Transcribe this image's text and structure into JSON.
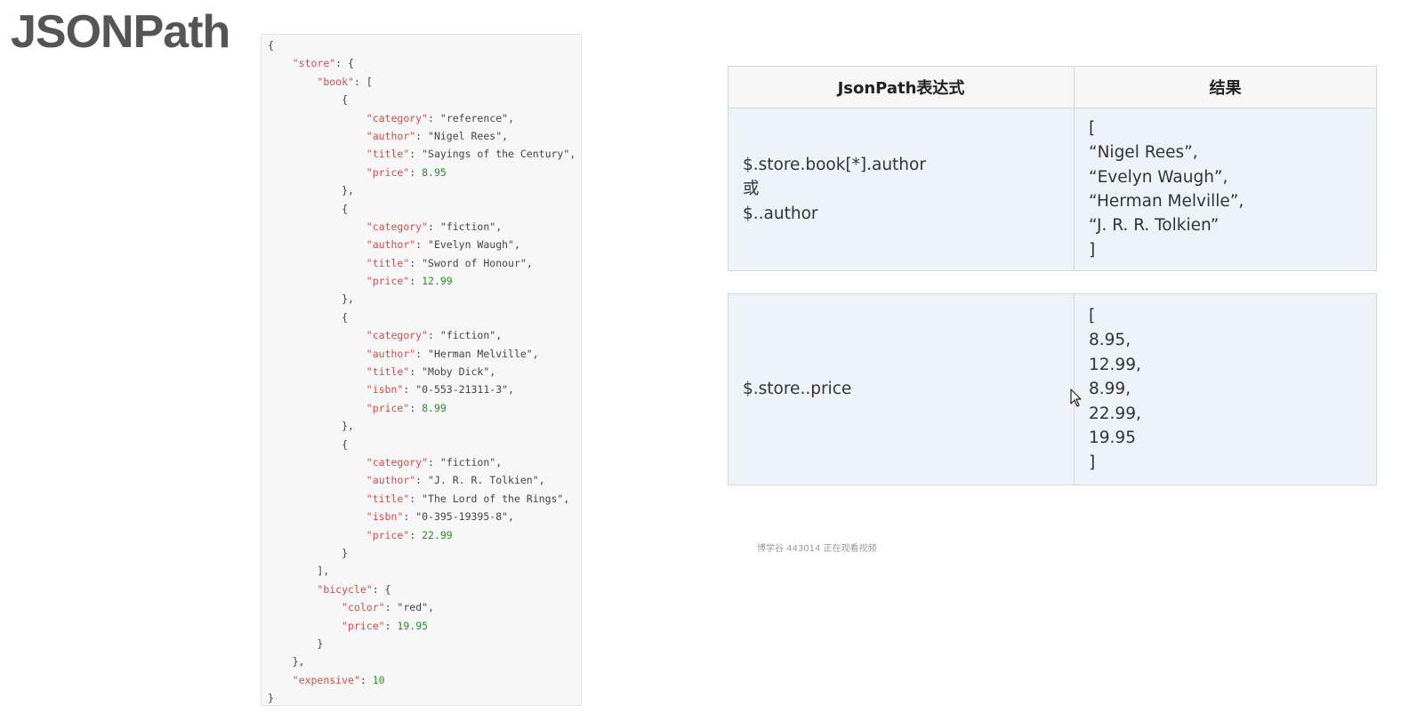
{
  "title": "JSONPath",
  "code_lines": [
    [
      {
        "t": "{",
        "c": "p"
      }
    ],
    [
      {
        "t": "    ",
        "c": "p"
      },
      {
        "t": "\"store\"",
        "c": "k"
      },
      {
        "t": ": {",
        "c": "p"
      }
    ],
    [
      {
        "t": "        ",
        "c": "p"
      },
      {
        "t": "\"book\"",
        "c": "k"
      },
      {
        "t": ": [",
        "c": "p"
      }
    ],
    [
      {
        "t": "            {",
        "c": "p"
      }
    ],
    [
      {
        "t": "                ",
        "c": "p"
      },
      {
        "t": "\"category\"",
        "c": "k"
      },
      {
        "t": ": ",
        "c": "p"
      },
      {
        "t": "\"reference\"",
        "c": "s"
      },
      {
        "t": ",",
        "c": "p"
      }
    ],
    [
      {
        "t": "                ",
        "c": "p"
      },
      {
        "t": "\"author\"",
        "c": "k"
      },
      {
        "t": ": ",
        "c": "p"
      },
      {
        "t": "\"Nigel Rees\"",
        "c": "s"
      },
      {
        "t": ",",
        "c": "p"
      }
    ],
    [
      {
        "t": "                ",
        "c": "p"
      },
      {
        "t": "\"title\"",
        "c": "k"
      },
      {
        "t": ": ",
        "c": "p"
      },
      {
        "t": "\"Sayings of the Century\"",
        "c": "s"
      },
      {
        "t": ",",
        "c": "p"
      }
    ],
    [
      {
        "t": "                ",
        "c": "p"
      },
      {
        "t": "\"price\"",
        "c": "k"
      },
      {
        "t": ": ",
        "c": "p"
      },
      {
        "t": "8.95",
        "c": "n"
      }
    ],
    [
      {
        "t": "            },",
        "c": "p"
      }
    ],
    [
      {
        "t": "            {",
        "c": "p"
      }
    ],
    [
      {
        "t": "                ",
        "c": "p"
      },
      {
        "t": "\"category\"",
        "c": "k"
      },
      {
        "t": ": ",
        "c": "p"
      },
      {
        "t": "\"fiction\"",
        "c": "s"
      },
      {
        "t": ",",
        "c": "p"
      }
    ],
    [
      {
        "t": "                ",
        "c": "p"
      },
      {
        "t": "\"author\"",
        "c": "k"
      },
      {
        "t": ": ",
        "c": "p"
      },
      {
        "t": "\"Evelyn Waugh\"",
        "c": "s"
      },
      {
        "t": ",",
        "c": "p"
      }
    ],
    [
      {
        "t": "                ",
        "c": "p"
      },
      {
        "t": "\"title\"",
        "c": "k"
      },
      {
        "t": ": ",
        "c": "p"
      },
      {
        "t": "\"Sword of Honour\"",
        "c": "s"
      },
      {
        "t": ",",
        "c": "p"
      }
    ],
    [
      {
        "t": "                ",
        "c": "p"
      },
      {
        "t": "\"price\"",
        "c": "k"
      },
      {
        "t": ": ",
        "c": "p"
      },
      {
        "t": "12.99",
        "c": "n"
      }
    ],
    [
      {
        "t": "            },",
        "c": "p"
      }
    ],
    [
      {
        "t": "            {",
        "c": "p"
      }
    ],
    [
      {
        "t": "                ",
        "c": "p"
      },
      {
        "t": "\"category\"",
        "c": "k"
      },
      {
        "t": ": ",
        "c": "p"
      },
      {
        "t": "\"fiction\"",
        "c": "s"
      },
      {
        "t": ",",
        "c": "p"
      }
    ],
    [
      {
        "t": "                ",
        "c": "p"
      },
      {
        "t": "\"author\"",
        "c": "k"
      },
      {
        "t": ": ",
        "c": "p"
      },
      {
        "t": "\"Herman Melville\"",
        "c": "s"
      },
      {
        "t": ",",
        "c": "p"
      }
    ],
    [
      {
        "t": "                ",
        "c": "p"
      },
      {
        "t": "\"title\"",
        "c": "k"
      },
      {
        "t": ": ",
        "c": "p"
      },
      {
        "t": "\"Moby Dick\"",
        "c": "s"
      },
      {
        "t": ",",
        "c": "p"
      }
    ],
    [
      {
        "t": "                ",
        "c": "p"
      },
      {
        "t": "\"isbn\"",
        "c": "k"
      },
      {
        "t": ": ",
        "c": "p"
      },
      {
        "t": "\"0-553-21311-3\"",
        "c": "s"
      },
      {
        "t": ",",
        "c": "p"
      }
    ],
    [
      {
        "t": "                ",
        "c": "p"
      },
      {
        "t": "\"price\"",
        "c": "k"
      },
      {
        "t": ": ",
        "c": "p"
      },
      {
        "t": "8.99",
        "c": "n"
      }
    ],
    [
      {
        "t": "            },",
        "c": "p"
      }
    ],
    [
      {
        "t": "            {",
        "c": "p"
      }
    ],
    [
      {
        "t": "                ",
        "c": "p"
      },
      {
        "t": "\"category\"",
        "c": "k"
      },
      {
        "t": ": ",
        "c": "p"
      },
      {
        "t": "\"fiction\"",
        "c": "s"
      },
      {
        "t": ",",
        "c": "p"
      }
    ],
    [
      {
        "t": "                ",
        "c": "p"
      },
      {
        "t": "\"author\"",
        "c": "k"
      },
      {
        "t": ": ",
        "c": "p"
      },
      {
        "t": "\"J. R. R. Tolkien\"",
        "c": "s"
      },
      {
        "t": ",",
        "c": "p"
      }
    ],
    [
      {
        "t": "                ",
        "c": "p"
      },
      {
        "t": "\"title\"",
        "c": "k"
      },
      {
        "t": ": ",
        "c": "p"
      },
      {
        "t": "\"The Lord of the Rings\"",
        "c": "s"
      },
      {
        "t": ",",
        "c": "p"
      }
    ],
    [
      {
        "t": "                ",
        "c": "p"
      },
      {
        "t": "\"isbn\"",
        "c": "k"
      },
      {
        "t": ": ",
        "c": "p"
      },
      {
        "t": "\"0-395-19395-8\"",
        "c": "s"
      },
      {
        "t": ",",
        "c": "p"
      }
    ],
    [
      {
        "t": "                ",
        "c": "p"
      },
      {
        "t": "\"price\"",
        "c": "k"
      },
      {
        "t": ": ",
        "c": "p"
      },
      {
        "t": "22.99",
        "c": "n"
      }
    ],
    [
      {
        "t": "            }",
        "c": "p"
      }
    ],
    [
      {
        "t": "        ],",
        "c": "p"
      }
    ],
    [
      {
        "t": "        ",
        "c": "p"
      },
      {
        "t": "\"bicycle\"",
        "c": "k"
      },
      {
        "t": ": {",
        "c": "p"
      }
    ],
    [
      {
        "t": "            ",
        "c": "p"
      },
      {
        "t": "\"color\"",
        "c": "k"
      },
      {
        "t": ": ",
        "c": "p"
      },
      {
        "t": "\"red\"",
        "c": "s"
      },
      {
        "t": ",",
        "c": "p"
      }
    ],
    [
      {
        "t": "            ",
        "c": "p"
      },
      {
        "t": "\"price\"",
        "c": "k"
      },
      {
        "t": ": ",
        "c": "p"
      },
      {
        "t": "19.95",
        "c": "n"
      }
    ],
    [
      {
        "t": "        }",
        "c": "p"
      }
    ],
    [
      {
        "t": "    },",
        "c": "p"
      }
    ],
    [
      {
        "t": "    ",
        "c": "p"
      },
      {
        "t": "\"expensive\"",
        "c": "k"
      },
      {
        "t": ": ",
        "c": "p"
      },
      {
        "t": "10",
        "c": "n"
      }
    ],
    [
      {
        "t": "}",
        "c": "p"
      }
    ]
  ],
  "table": {
    "header_expr": "JsonPath表达式",
    "header_result": "结果",
    "row1": {
      "expr_lines": [
        "$.store.book[*].author",
        "或",
        "$..author"
      ],
      "result_lines": [
        "[",
        "“Nigel Rees”,",
        "“Evelyn Waugh”,",
        "“Herman Melville”,",
        "“J. R. R. Tolkien”",
        "]"
      ]
    },
    "row2": {
      "expr_lines": [
        "$.store..price"
      ],
      "result_lines": [
        "[",
        "8.95,",
        "12.99,",
        "8.99,",
        "22.99,",
        "19.95",
        "]"
      ]
    }
  },
  "watermark": "博学谷 443014 正在观看视频",
  "colors": {
    "key": "#d14b4b",
    "number": "#2e8b2e",
    "cell_bg": "#eef3fa",
    "header_bg": "#f7f7f7"
  }
}
